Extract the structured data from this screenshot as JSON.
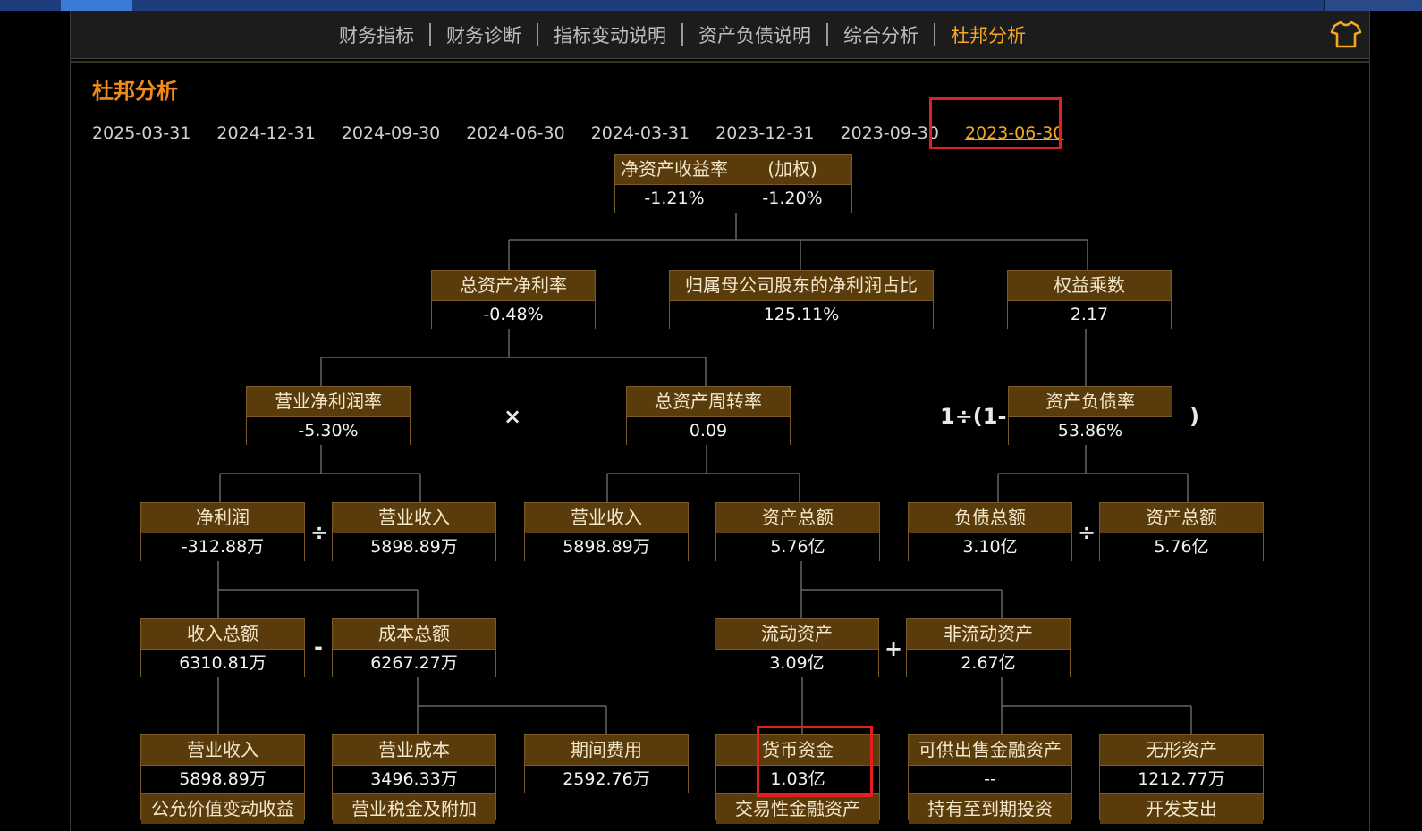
{
  "tabs": [
    {
      "label": "财务指标",
      "active": false
    },
    {
      "label": "财务诊断",
      "active": false
    },
    {
      "label": "指标变动说明",
      "active": false
    },
    {
      "label": "资产负债说明",
      "active": false
    },
    {
      "label": "综合分析",
      "active": false
    },
    {
      "label": "杜邦分析",
      "active": true
    }
  ],
  "section_title": "杜邦分析",
  "dates": [
    "2025-03-31",
    "2024-12-31",
    "2024-09-30",
    "2024-06-30",
    "2024-03-31",
    "2023-12-31",
    "2023-09-30",
    "2023-06-30"
  ],
  "selected_date": "2023-06-30",
  "roe": {
    "label_a": "净资产收益率",
    "label_b": "(加权)",
    "value_a": "-1.21%",
    "value_b": "-1.20%"
  },
  "nodes": {
    "roa": {
      "label": "总资产净利率",
      "value": "-0.48%"
    },
    "parent_share": {
      "label": "归属母公司股东的净利润占比",
      "value": "125.11%"
    },
    "equity_mult": {
      "label": "权益乘数",
      "value": "2.17"
    },
    "net_margin": {
      "label": "营业净利润率",
      "value": "-5.30%"
    },
    "asset_turnover": {
      "label": "总资产周转率",
      "value": "0.09"
    },
    "debt_ratio": {
      "label": "资产负债率",
      "value": "53.86%"
    },
    "net_profit": {
      "label": "净利润",
      "value": "-312.88万"
    },
    "revenue_a": {
      "label": "营业收入",
      "value": "5898.89万"
    },
    "revenue_b": {
      "label": "营业收入",
      "value": "5898.89万"
    },
    "total_assets_a": {
      "label": "资产总额",
      "value": "5.76亿"
    },
    "total_liab": {
      "label": "负债总额",
      "value": "3.10亿"
    },
    "total_assets_b": {
      "label": "资产总额",
      "value": "5.76亿"
    },
    "total_income": {
      "label": "收入总额",
      "value": "6310.81万"
    },
    "total_cost": {
      "label": "成本总额",
      "value": "6267.27万"
    },
    "current_assets": {
      "label": "流动资产",
      "value": "3.09亿"
    },
    "noncurrent_assets": {
      "label": "非流动资产",
      "value": "2.67亿"
    },
    "revenue_c": {
      "label": "营业收入",
      "value": "5898.89万"
    },
    "op_cost": {
      "label": "营业成本",
      "value": "3496.33万"
    },
    "period_exp": {
      "label": "期间费用",
      "value": "2592.76万"
    },
    "cash": {
      "label": "货币资金",
      "value": "1.03亿"
    },
    "afs_assets": {
      "label": "可供出售金融资产",
      "value": "--"
    },
    "intangible": {
      "label": "无形资产",
      "value": "1212.77万"
    },
    "fv_change": {
      "label": "公允价值变动收益"
    },
    "tax_surcharge": {
      "label": "营业税金及附加"
    },
    "trading_assets": {
      "label": "交易性金融资产"
    },
    "htm_invest": {
      "label": "持有至到期投资"
    },
    "dev_exp": {
      "label": "开发支出"
    }
  },
  "operators": {
    "times": "×",
    "divide": "÷",
    "minus": "-",
    "plus": "+",
    "one_minus": "1÷(1-",
    "close_paren": ")"
  },
  "colors": {
    "accent": "#f5a623",
    "node_label_bg": "#5a3c0c",
    "highlight": "#e41e1e",
    "title": "#f08a1a"
  },
  "icons": {
    "theme": "shirt-icon"
  }
}
